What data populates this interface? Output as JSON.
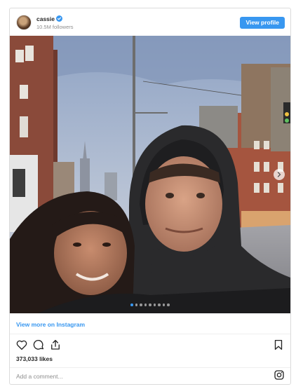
{
  "header": {
    "username": "cassie",
    "followers": "10.5M followers",
    "view_profile_label": "View profile"
  },
  "media": {
    "carousel_dots": 9,
    "active_dot": 0
  },
  "footer": {
    "view_more_label": "View more on Instagram",
    "likes": "373,033 likes",
    "comment_placeholder": "Add a comment..."
  },
  "colors": {
    "accent": "#3897f0",
    "border": "#dbdbdb"
  },
  "icons": [
    "verified-badge-icon",
    "chevron-right-icon",
    "heart-icon",
    "comment-icon",
    "share-icon",
    "bookmark-icon",
    "instagram-icon"
  ]
}
